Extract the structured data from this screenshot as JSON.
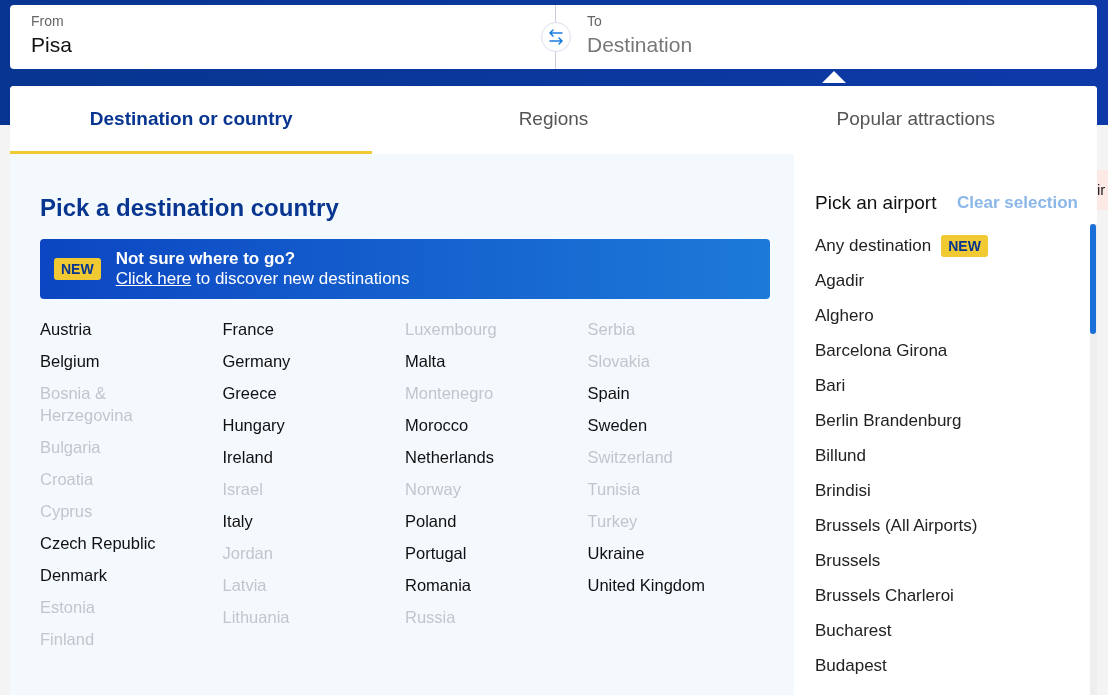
{
  "search": {
    "from": {
      "label": "From",
      "value": "Pisa"
    },
    "to": {
      "label": "To",
      "placeholder": "Destination"
    }
  },
  "tabs": [
    {
      "label": "Destination or country",
      "selected": true
    },
    {
      "label": "Regions",
      "selected": false
    },
    {
      "label": "Popular attractions",
      "selected": false
    }
  ],
  "countries": {
    "title": "Pick a destination country",
    "banner": {
      "badge": "NEW",
      "headline": "Not sure where to go?",
      "link": "Click here",
      "text": " to discover new destinations"
    },
    "columns": [
      {
        "items": [
          {
            "name": "Austria",
            "disabled": false
          },
          {
            "name": "Belgium",
            "disabled": false
          },
          {
            "name": "Bosnia & Herzegovina",
            "disabled": true
          },
          {
            "name": "Bulgaria",
            "disabled": true
          },
          {
            "name": "Croatia",
            "disabled": true
          },
          {
            "name": "Cyprus",
            "disabled": true
          },
          {
            "name": "Czech Republic",
            "disabled": false
          },
          {
            "name": "Denmark",
            "disabled": false
          },
          {
            "name": "Estonia",
            "disabled": true
          },
          {
            "name": "Finland",
            "disabled": true
          }
        ]
      },
      {
        "items": [
          {
            "name": "France",
            "disabled": false
          },
          {
            "name": "Germany",
            "disabled": false
          },
          {
            "name": "Greece",
            "disabled": false
          },
          {
            "name": "Hungary",
            "disabled": false
          },
          {
            "name": "Ireland",
            "disabled": false
          },
          {
            "name": "Israel",
            "disabled": true
          },
          {
            "name": "Italy",
            "disabled": false
          },
          {
            "name": "Jordan",
            "disabled": true
          },
          {
            "name": "Latvia",
            "disabled": true
          },
          {
            "name": "Lithuania",
            "disabled": true
          }
        ]
      },
      {
        "items": [
          {
            "name": "Luxembourg",
            "disabled": true
          },
          {
            "name": "Malta",
            "disabled": false
          },
          {
            "name": "Montenegro",
            "disabled": true
          },
          {
            "name": "Morocco",
            "disabled": false
          },
          {
            "name": "Netherlands",
            "disabled": false
          },
          {
            "name": "Norway",
            "disabled": true
          },
          {
            "name": "Poland",
            "disabled": false
          },
          {
            "name": "Portugal",
            "disabled": false
          },
          {
            "name": "Romania",
            "disabled": false
          },
          {
            "name": "Russia",
            "disabled": true
          }
        ]
      },
      {
        "items": [
          {
            "name": "Serbia",
            "disabled": true
          },
          {
            "name": "Slovakia",
            "disabled": true
          },
          {
            "name": "Spain",
            "disabled": false
          },
          {
            "name": "Sweden",
            "disabled": false
          },
          {
            "name": "Switzerland",
            "disabled": true
          },
          {
            "name": "Tunisia",
            "disabled": true
          },
          {
            "name": "Turkey",
            "disabled": true
          },
          {
            "name": "Ukraine",
            "disabled": false
          },
          {
            "name": "United Kingdom",
            "disabled": false
          }
        ]
      }
    ]
  },
  "airports": {
    "title": "Pick an airport",
    "clear": "Clear selection",
    "items": [
      {
        "name": "Any destination",
        "badge": "NEW"
      },
      {
        "name": "Agadir"
      },
      {
        "name": "Alghero"
      },
      {
        "name": "Barcelona Girona"
      },
      {
        "name": "Bari"
      },
      {
        "name": "Berlin Brandenburg"
      },
      {
        "name": "Billund"
      },
      {
        "name": "Brindisi"
      },
      {
        "name": "Brussels (All Airports)"
      },
      {
        "name": "Brussels"
      },
      {
        "name": "Brussels Charleroi"
      },
      {
        "name": "Bucharest"
      },
      {
        "name": "Budapest"
      }
    ]
  },
  "background_fragment": "ir"
}
